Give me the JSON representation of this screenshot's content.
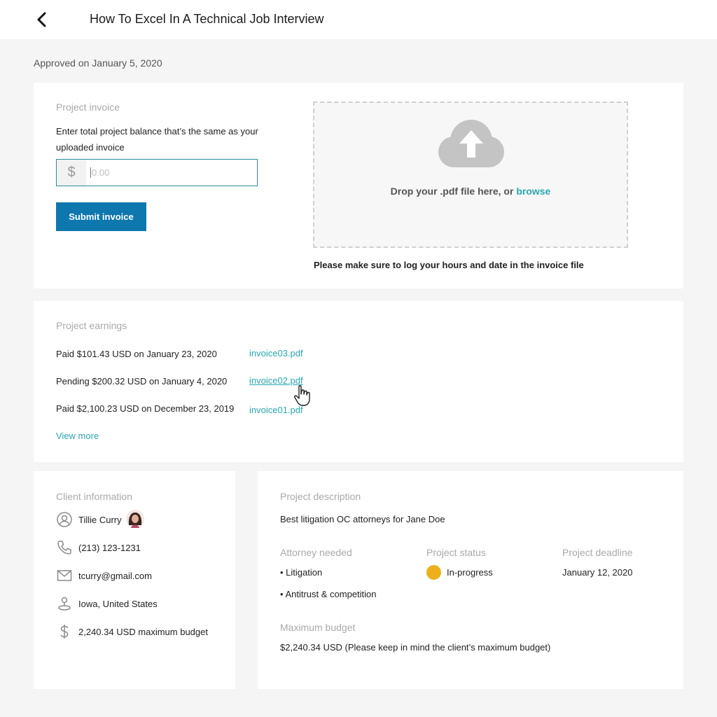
{
  "header": {
    "title": "How To Excel In A Technical Job Interview",
    "back_icon": "chevron-left-icon"
  },
  "approved_text": "Approved on January 5, 2020",
  "invoice": {
    "section_label": "Project invoice",
    "instruction": "Enter total project balance that’s the same as your uploaded invoice",
    "currency_symbol": "$",
    "amount_placeholder": "0.00",
    "amount_value": "",
    "submit_label": "Submit invoice",
    "dropzone_text": "Drop your .pdf file here, or",
    "browse_label": "browse",
    "dropzone_icon": "cloud-upload-icon",
    "note": "Please make sure to log your hours and date in the invoice file"
  },
  "earnings": {
    "section_label": "Project earnings",
    "items": [
      {
        "text": "Paid $101.43 USD on January 23, 2020",
        "file": "invoice03.pdf"
      },
      {
        "text": "Pending $200.32 USD on January 4, 2020",
        "file": "invoice02.pdf"
      },
      {
        "text": "Paid $2,100.23 USD on December 23, 2019",
        "file": "invoice01.pdf"
      }
    ],
    "view_more_label": "View more"
  },
  "client": {
    "section_label": "Client information",
    "name": "Tillie Curry",
    "phone": "(213) 123-1231",
    "email": "tcurry@gmail.com",
    "location": "Iowa, United States",
    "budget": "2,240.34 USD maximum budget",
    "icons": [
      "user-icon",
      "phone-icon",
      "mail-icon",
      "location-pin-icon",
      "dollar-icon"
    ]
  },
  "description": {
    "section_label": "Project description",
    "text": "Best litigation OC attorneys for Jane Doe",
    "attorney_label": "Attorney needed",
    "attorney_items": [
      "• Litigation",
      "• Antitrust & competition"
    ],
    "status_label": "Project status",
    "status_value": "In-progress",
    "status_color": "#ecb01a",
    "deadline_label": "Project deadline",
    "deadline_value": "January 12, 2020",
    "budget_label": "Maximum budget",
    "budget_value": "$2,240.34 USD (Please keep in mind the client’s maximum budget)"
  },
  "colors": {
    "primary_button": "#0e77ae",
    "link": "#2aa6ae",
    "input_border": "#2b8a98"
  }
}
